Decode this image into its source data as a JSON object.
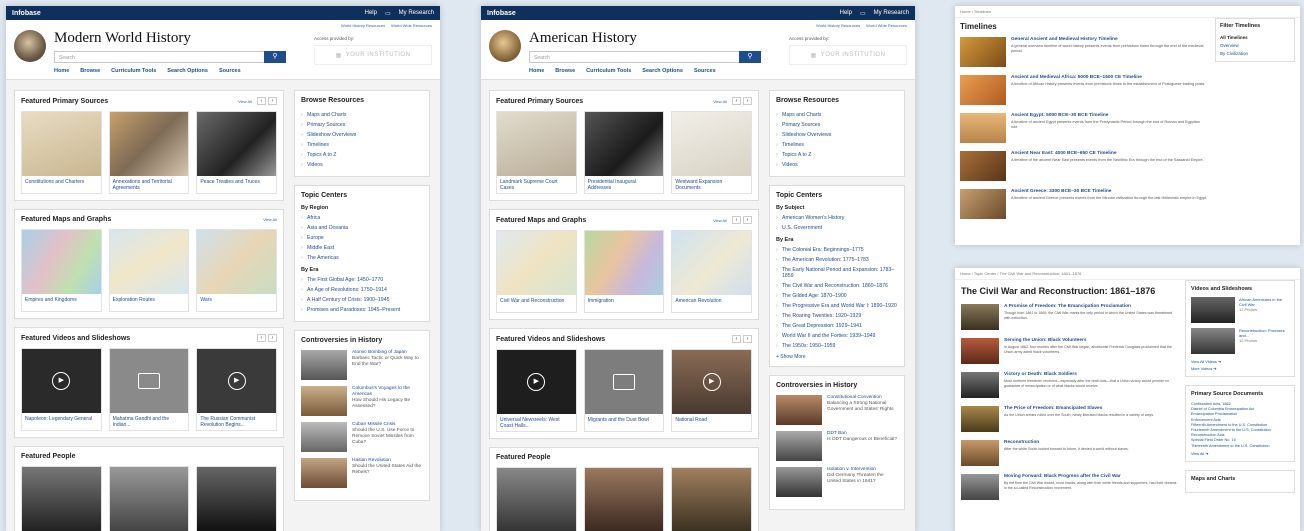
{
  "brand": {
    "logo": "Infobase",
    "help": "Help",
    "my_research": "My Research"
  },
  "access": {
    "provided_by": "Access provided by:",
    "institution": "YOUR INSTITUTION"
  },
  "search": {
    "placeholder": "Search"
  },
  "nav": [
    "Home",
    "Browse",
    "Curriculum Tools",
    "Search Options",
    "Sources"
  ],
  "mwh": {
    "title": "Modern World History",
    "sublinks": [
      "World History Resources",
      "World Wide Resources"
    ],
    "primary": {
      "heading": "Featured Primary Sources",
      "view_all": "View All",
      "items": [
        "Constitutions and Charters",
        "Annexations and Territorial Agreements",
        "Peace Treaties and Truces"
      ]
    },
    "maps": {
      "heading": "Featured Maps and Graphs",
      "view_all": "View All",
      "items": [
        "Empires and Kingdoms",
        "Exploration Routes",
        "Wars"
      ]
    },
    "videos": {
      "heading": "Featured Videos and Slideshows",
      "items": [
        "Napoleon: Legendary General",
        "Mahatma Gandhi and the Indian...",
        "The Russian Communist Revolution Begins..."
      ]
    },
    "people": {
      "heading": "Featured People"
    },
    "browse": {
      "heading": "Browse Resources",
      "items": [
        "Maps and Charts",
        "Primary Sources",
        "Slideshow Overviews",
        "Timelines",
        "Topics A to Z",
        "Videos"
      ]
    },
    "topics": {
      "heading": "Topic Centers",
      "by_region": "By Region",
      "regions": [
        "Africa",
        "Asia and Oceania",
        "Europe",
        "Middle East",
        "The Americas"
      ],
      "by_era": "By Era",
      "eras": [
        "The First Global Age: 1450–1770",
        "An Age of Revolutions: 1750–1914",
        "A Half Century of Crisis: 1900–1945",
        "Promises and Paradoxes: 1945–Present"
      ]
    },
    "controversies": {
      "heading": "Controversies in History",
      "items": [
        {
          "title": "Atomic Bombing of Japan",
          "desc": "Barbaric Tactic or Quick Way to End the War?"
        },
        {
          "title": "Columbus's Voyages to the Americas",
          "desc": "How Should His Legacy Be Assessed?"
        },
        {
          "title": "Cuban Missile Crisis",
          "desc": "Should the U.S. Use Force to Remove Soviet Missiles from Cuba?"
        },
        {
          "title": "Haitian Revolution",
          "desc": "Should the United States Aid the Rebels?"
        }
      ]
    }
  },
  "ah": {
    "title": "American History",
    "sublinks": [
      "World History Resources",
      "World Wide Resources"
    ],
    "primary": {
      "heading": "Featured Primary Sources",
      "view_all": "View All",
      "items": [
        "Landmark Supreme Court Cases",
        "Presidential Inaugural Addresses",
        "Westward Expansion Documents"
      ]
    },
    "maps": {
      "heading": "Featured Maps and Graphs",
      "view_all": "View All",
      "items": [
        "Civil War and Reconstruction",
        "Immigration",
        "American Revolution"
      ]
    },
    "videos": {
      "heading": "Featured Videos and Slideshows",
      "items": [
        "Universal Newsreels: West Coast Halls...",
        "Migrants and the Dust Bowl",
        "National Road"
      ]
    },
    "people": {
      "heading": "Featured People"
    },
    "browse": {
      "heading": "Browse Resources",
      "items": [
        "Maps and Charts",
        "Primary Sources",
        "Slideshow Overviews",
        "Timelines",
        "Topics A to Z",
        "Videos"
      ]
    },
    "topics": {
      "heading": "Topic Centers",
      "by_subject": "By Subject",
      "subjects": [
        "American Women's History",
        "U.S. Government"
      ],
      "by_era": "By Era",
      "eras": [
        "The Colonial Era: Beginnings–1775",
        "The American Revolution: 1775–1783",
        "The Early National Period and Expansion: 1783–1859",
        "The Civil War and Reconstruction: 1860–1876",
        "The Gilded Age: 1870–1900",
        "The Progressive Era and World War I: 1890–1920",
        "The Roaring Twenties: 1920–1929",
        "The Great Depression: 1929–1941",
        "World War II and the Forties: 1939–1949",
        "The 1950s: 1950–1959"
      ],
      "show_more": "+ Show More"
    },
    "controversies": {
      "heading": "Controversies in History",
      "items": [
        {
          "title": "Constitutional Convention",
          "desc": "Balancing a Strong National Government and States' Rights"
        },
        {
          "title": "DDT Ban",
          "desc": "Is DDT Dangerous or Beneficial?"
        },
        {
          "title": "Isolation v. Intervention",
          "desc": "Did Germany Threaten the United States in 1941?"
        }
      ]
    }
  },
  "timelines": {
    "crumb": "Home / Timelines",
    "title": "Timelines",
    "filter": {
      "heading": "Filter Timelines",
      "options": [
        "All Timelines",
        "Overview",
        "By Civilization"
      ]
    },
    "items": [
      {
        "title": "General Ancient and Medieval History Timeline",
        "desc": "A general overview timeline of world history presents events from prehistoric times through the end of the medieval period."
      },
      {
        "title": "Ancient and Medieval Africa: 5000 BCE–1500 CE Timeline",
        "desc": "A timeline of African history presents events from prehistoric times to the establishment of Portuguese trading posts."
      },
      {
        "title": "Ancient Egypt: 5000 BCE–30 BCE Timeline",
        "desc": "A timeline of ancient Egypt presents events from the Predynastic Period through the end of Roman and Egyptian rule."
      },
      {
        "title": "Ancient Near East: 4000 BCE–650 CE Timeline",
        "desc": "A timeline of the ancient Near East presents events from the Neolithic Era through the end of the Sassanid Empire."
      },
      {
        "title": "Ancient Greece: 3300 BCE–30 BCE Timeline",
        "desc": "A timeline of ancient Greece presents events from the Minoan civilization through the last Hellenistic empire in Egypt."
      }
    ]
  },
  "civilwar": {
    "crumb": "Home / Topic Center / The Civil War and Reconstruction: 1861–1876",
    "title": "The Civil War and Reconstruction: 1861–1876",
    "items": [
      {
        "title": "A Promise of Freedom: The Emancipation Proclamation",
        "desc": "Though from 1861 to 1865, the Civil War marks the only period in which the United States was threatened with extinction."
      },
      {
        "title": "Serving the Union: Black Volunteers",
        "desc": "In August 1862, four months after the Civil War began, abolitionist Frederick Douglass proclaimed that the Union army admit black volunteers."
      },
      {
        "title": "Victory or Death: Black Soldiers",
        "desc": "Most northern freedmen received—especially after the draft riots—that a Union victory would provide no guarantee of emancipation or of what blacks would receive."
      },
      {
        "title": "The Price of Freedom: Emancipated Slaves",
        "desc": "As the Union armies rolled over the South, newly liberated blacks resulted in a variety of ways."
      },
      {
        "title": "Reconstruction",
        "desc": "After the white South looked forward to future, it denied a world without slaves."
      },
      {
        "title": "Moving Forward: Black Progress after the Civil War",
        "desc": "By the time the Civil War ended, most blacks, along with their white friends and supporters, had their dreams in the so-called Reconstruction movement."
      }
    ],
    "videos": {
      "heading": "Videos and Slideshows",
      "items": [
        "African Americans in the Civil War",
        "Reconstruction: Promises and..."
      ],
      "photos": "12 Photos",
      "view_all": "View All Videos ➔",
      "more": "More Videos ➔"
    },
    "docs": {
      "heading": "Primary Source Documents",
      "items": [
        "Confiscation Acts, 1862",
        "District of Columbia Emancipation Act",
        "Emancipation Proclamation",
        "Enforcement Acts",
        "Fifteenth Amendment to the U.S. Constitution",
        "Fourteenth Amendment to the U.S. Constitution",
        "Reconstruction Acts",
        "Special Field Order No. 15",
        "Thirteenth Amendment to the U.S. Constitution"
      ],
      "more": "View All ➔"
    },
    "maps": {
      "heading": "Maps and Charts"
    }
  },
  "colors": {
    "navy": "#0f2f5c",
    "link": "#1e4d8f",
    "search_button": "#1e4d8f"
  }
}
